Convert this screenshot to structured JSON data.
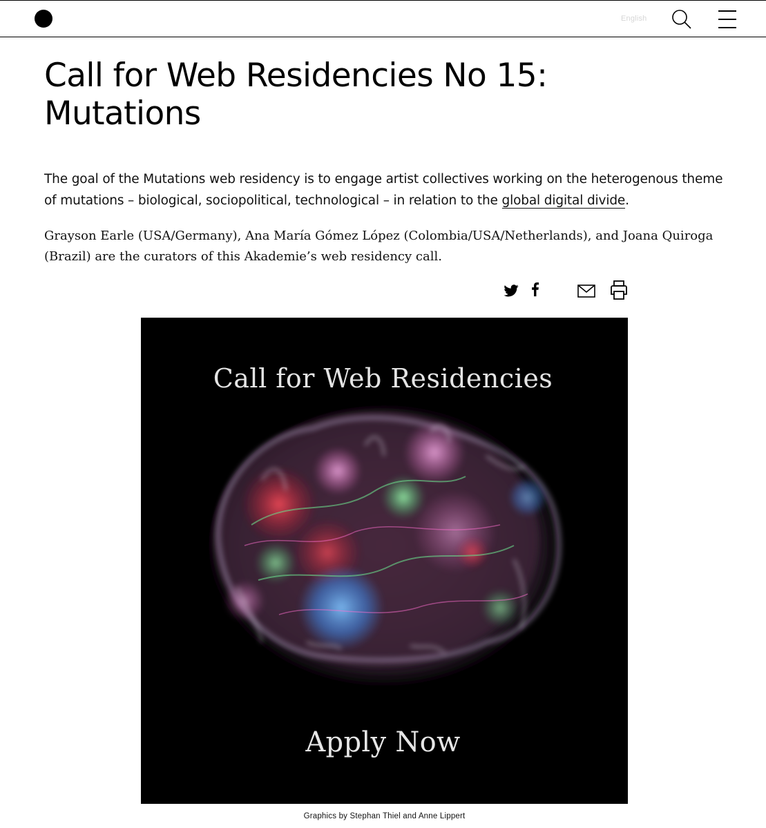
{
  "header": {
    "language_label": "English",
    "logo_icon": "filled-circle-logo",
    "search_icon": "search-icon",
    "menu_icon": "hamburger-menu-icon"
  },
  "article": {
    "title_line1": "Call for Web Residencies No 15:",
    "title_line2": "Mutations",
    "intro_text": "The goal of the Mutations web residency is to engage artist collectives working on the heterogenous theme of mutations – biological, sociopolitical, technological – in relation to the",
    "intro_link": "global digital divide",
    "intro_end": ".",
    "curators_text": "Grayson Earle (USA/Germany), Ana María Gómez López (Colombia/USA/Netherlands), and Joana Quiroga (Brazil) are the curators of this Akademie’s web residency call."
  },
  "share": {
    "icons": [
      "twitter-icon",
      "facebook-icon",
      "mail-icon",
      "print-icon"
    ]
  },
  "poster": {
    "title": "Call for Web Residencies",
    "cta": "Apply Now",
    "caption": "Graphics by Stephan Thiel and Anne Lippert"
  },
  "colors": {
    "text": "#000000",
    "language_label": "#d6d6d6",
    "poster_background": "#000000"
  }
}
